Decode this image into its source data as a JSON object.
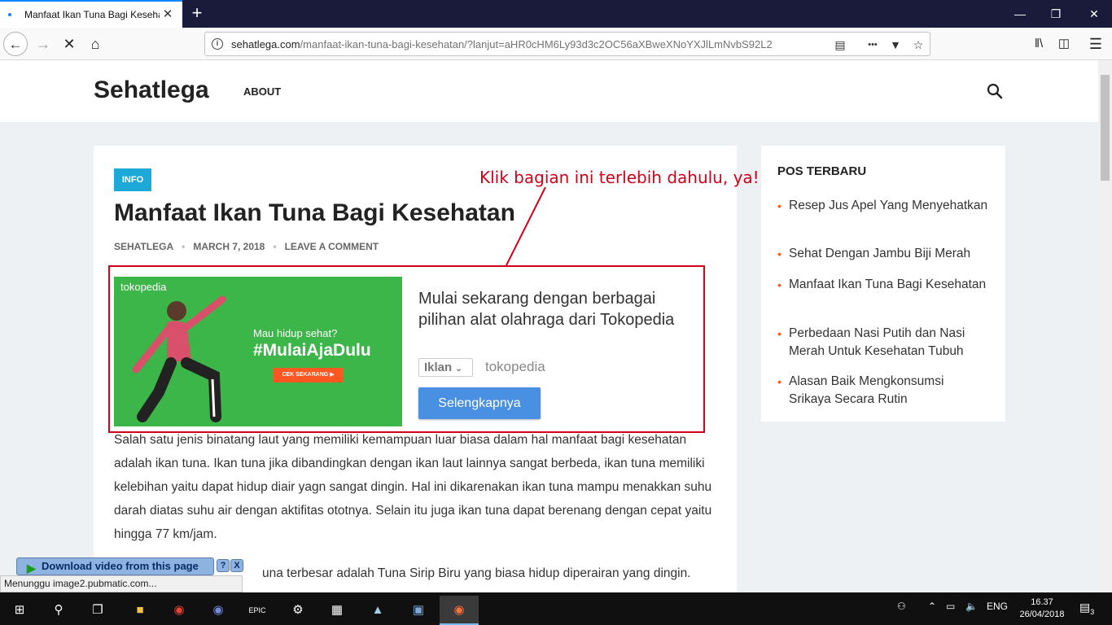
{
  "browser": {
    "tab_title": "Manfaat Ikan Tuna Bagi Kesehatan",
    "tab_close": "✕",
    "new_tab": "+",
    "url_host": "sehatlega.com",
    "url_rest": "/manfaat-ikan-tuna-bagi-kesehatan/?lanjut=aHR0cHM6Ly93d3c2OC56aXBweXNoYXJlLmNvbS92L2",
    "more": "•••"
  },
  "site": {
    "logo": "Sehatlega",
    "nav_about": "ABOUT"
  },
  "article": {
    "category": "INFO",
    "title": "Manfaat Ikan Tuna Bagi Kesehatan",
    "author": "SEHATLEGA",
    "date": "MARCH 7, 2018",
    "comment_link": "LEAVE A COMMENT",
    "paragraph1": "Salah satu jenis binatang laut yang memiliki kemampuan luar biasa dalam hal manfaat bagi kesehatan adalah ikan tuna. Ikan tuna jika dibandingkan dengan ikan laut lainnya sangat berbeda, ikan tuna memiliki kelebihan yaitu dapat hidup diair yagn sangat dingin. Hal ini dikarenakan ikan tuna mampu menakkan suhu darah diatas suhu air dengan aktifitas otot­nya. Selain itu juga ikan tuna dapat berenang dengan cepat yaitu hingga 77 km/jam.",
    "paragraph2_visible": "una terbesar adalah Tuna Sirip Biru yang biasa hidup diperairan yang dingin."
  },
  "ad": {
    "brand": "tokopedia",
    "tagline": "Mau hidup sehat?",
    "hashtag": "#MulaiAjaDulu",
    "cta_small": "CEK SEKARANG ▶",
    "headline": "Mulai sekarang dengan berbagai pilihan alat olahraga dari Tokopedia",
    "label": "Iklan",
    "advertiser": "tokopedia",
    "button": "Selengkapnya"
  },
  "annotation": {
    "text": "Klik bagian ini terlebih dahulu, ya!",
    "color": "#d0021b"
  },
  "sidebar": {
    "title": "POS TERBARU",
    "items": [
      {
        "label": "Resep Jus Apel Yang Menyehatkan"
      },
      {
        "label": "Sehat Dengan Jambu Biji Merah"
      },
      {
        "label": "Manfaat Ikan Tuna Bagi Kesehatan"
      },
      {
        "label": "Perbedaan Nasi Putih dan Nasi Merah Untuk Kesehatan Tubuh"
      },
      {
        "label": "Alasan Baik Mengkonsumsi Srikaya Secara Rutin"
      }
    ]
  },
  "overlay": {
    "download_label": "Download video from this page",
    "help": "?",
    "close": "X"
  },
  "status": {
    "text": "Menunggu image2.pubmatic.com..."
  },
  "taskbar": {
    "lang": "ENG",
    "time": "16.37",
    "date": "26/04/2018",
    "notification_count": "3"
  }
}
